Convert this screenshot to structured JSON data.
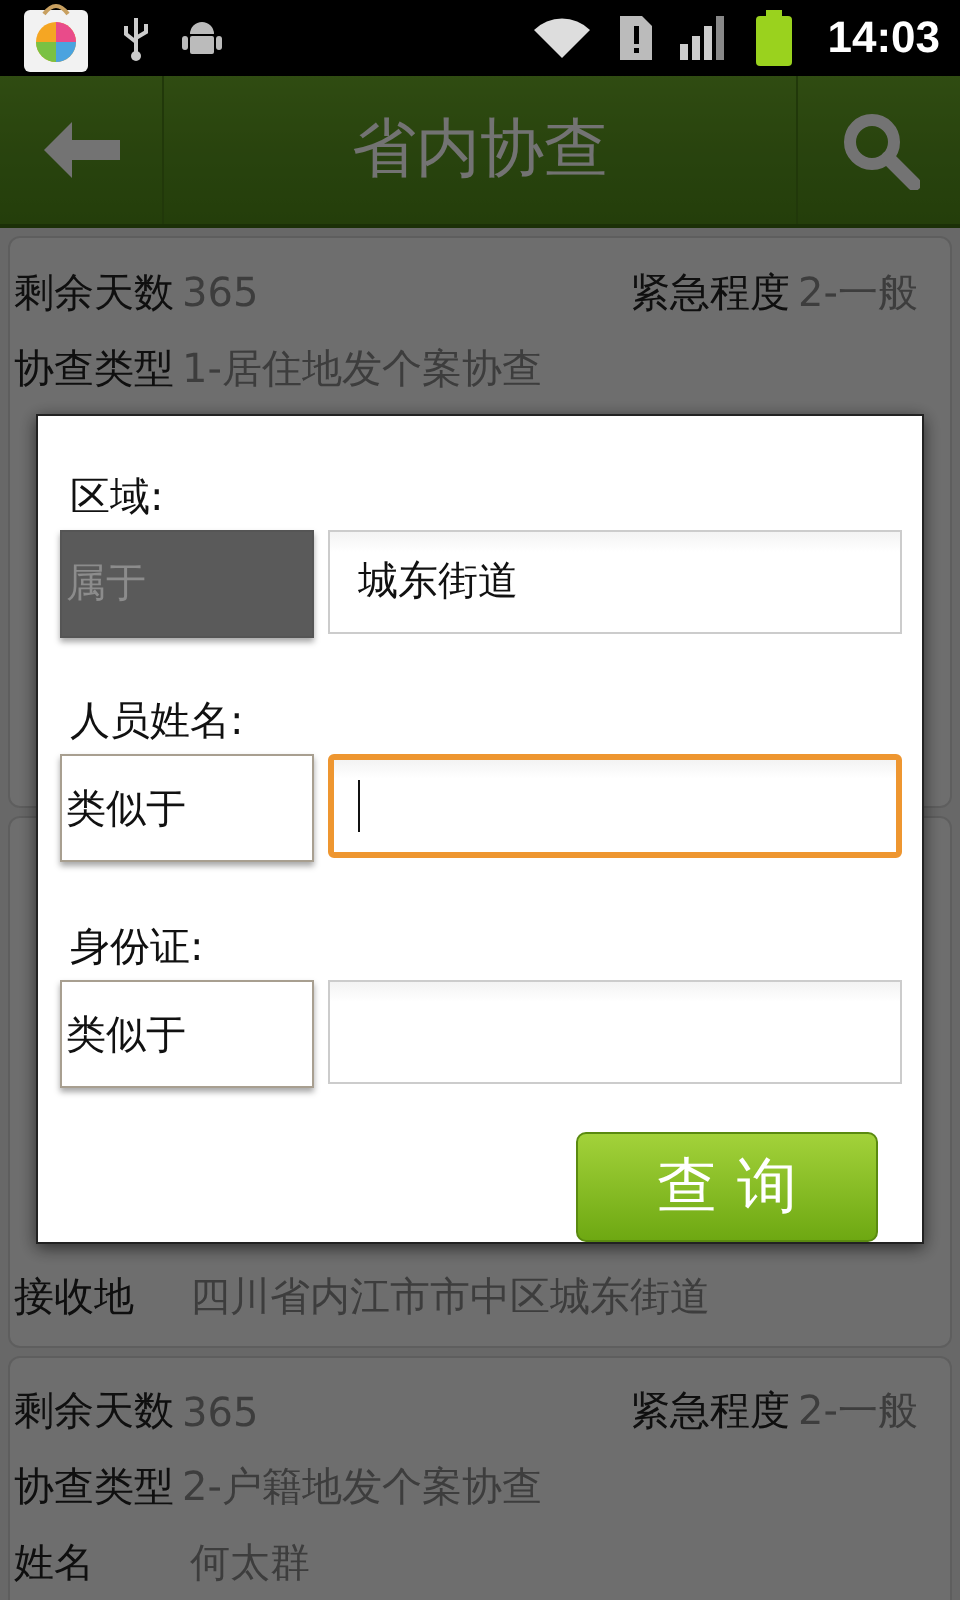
{
  "status_bar": {
    "time": "14:03"
  },
  "header": {
    "title": "省内协查"
  },
  "records": [
    {
      "top_row": [
        {
          "label": "剩余天数",
          "value": "365"
        },
        {
          "label": "紧急程度",
          "value": "2-一般"
        }
      ],
      "fields": [
        {
          "label": "协查类型",
          "value": "1-居住地发个案协查"
        }
      ]
    },
    {
      "fields": [
        {
          "label": "接收地",
          "value": "四川省内江市市中区城东街道"
        }
      ]
    },
    {
      "top_row": [
        {
          "label": "剩余天数",
          "value": "365"
        },
        {
          "label": "紧急程度",
          "value": "2-一般"
        }
      ],
      "fields": [
        {
          "label": "协查类型",
          "value": "2-户籍地发个案协查"
        },
        {
          "label": "姓名",
          "value": "何太群"
        }
      ]
    }
  ],
  "search_dialog": {
    "fields": [
      {
        "label": "区域:",
        "operator": "属于",
        "operator_disabled": true,
        "value": "城东街道",
        "focused": false
      },
      {
        "label": "人员姓名:",
        "operator": "类似于",
        "operator_disabled": false,
        "focused": true
      },
      {
        "label": "身份证:",
        "operator": "类似于",
        "operator_disabled": false,
        "focused": false
      }
    ],
    "button": "查 询"
  }
}
